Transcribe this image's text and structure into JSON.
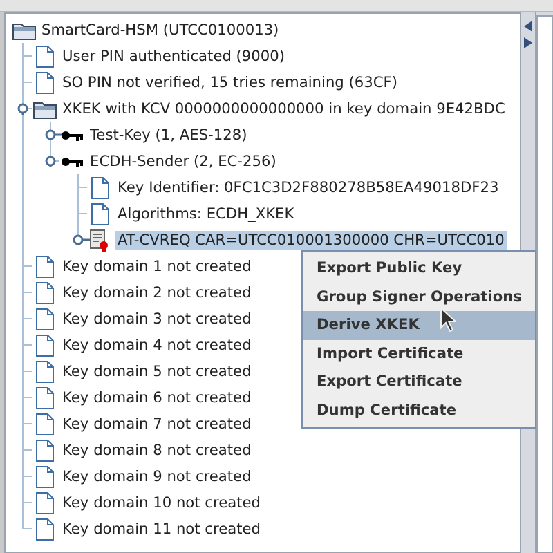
{
  "tree": {
    "label": "SmartCard-HSM (UTCC0100013)",
    "kind": "folder",
    "selected": false,
    "children": [
      {
        "label": "User PIN authenticated (9000)",
        "kind": "file",
        "selected": false
      },
      {
        "label": "SO PIN not verified, 15 tries remaining (63CF)",
        "kind": "file",
        "selected": false
      },
      {
        "label": "XKEK with KCV 0000000000000000 in key domain 9E42BDC",
        "kind": "folder",
        "selected": false,
        "expanded": true,
        "children": [
          {
            "label": "Test-Key (1, AES-128)",
            "kind": "key",
            "selected": false,
            "expanded": false
          },
          {
            "label": "ECDH-Sender (2, EC-256)",
            "kind": "key",
            "selected": false,
            "expanded": true,
            "children": [
              {
                "label": "Key Identifier: 0FC1C3D2F880278B58EA49018DF23",
                "kind": "file",
                "selected": false
              },
              {
                "label": "Algorithms: ECDH_XKEK",
                "kind": "file",
                "selected": false
              },
              {
                "label": "AT-CVREQ CAR=UTCC010001300000 CHR=UTCC010",
                "kind": "certificate",
                "selected": true,
                "expanded": false
              }
            ]
          }
        ]
      },
      {
        "label": "Key domain 1 not created",
        "kind": "file",
        "selected": false
      },
      {
        "label": "Key domain 2 not created",
        "kind": "file",
        "selected": false
      },
      {
        "label": "Key domain 3 not created",
        "kind": "file",
        "selected": false
      },
      {
        "label": "Key domain 4 not created",
        "kind": "file",
        "selected": false
      },
      {
        "label": "Key domain 5 not created",
        "kind": "file",
        "selected": false
      },
      {
        "label": "Key domain 6 not created",
        "kind": "file",
        "selected": false
      },
      {
        "label": "Key domain 7 not created",
        "kind": "file",
        "selected": false
      },
      {
        "label": "Key domain 8 not created",
        "kind": "file",
        "selected": false
      },
      {
        "label": "Key domain 9 not created",
        "kind": "file",
        "selected": false
      },
      {
        "label": "Key domain 10 not created",
        "kind": "file",
        "selected": false
      },
      {
        "label": "Key domain 11 not created",
        "kind": "file",
        "selected": false
      }
    ]
  },
  "context_menu": {
    "items": [
      {
        "label": "Export Public Key",
        "selected": false
      },
      {
        "label": "Group Signer Operations",
        "selected": false
      },
      {
        "label": "Derive XKEK",
        "selected": true
      },
      {
        "label": "Import Certificate",
        "selected": false
      },
      {
        "label": "Export Certificate",
        "selected": false
      },
      {
        "label": "Dump Certificate",
        "selected": false
      }
    ]
  }
}
